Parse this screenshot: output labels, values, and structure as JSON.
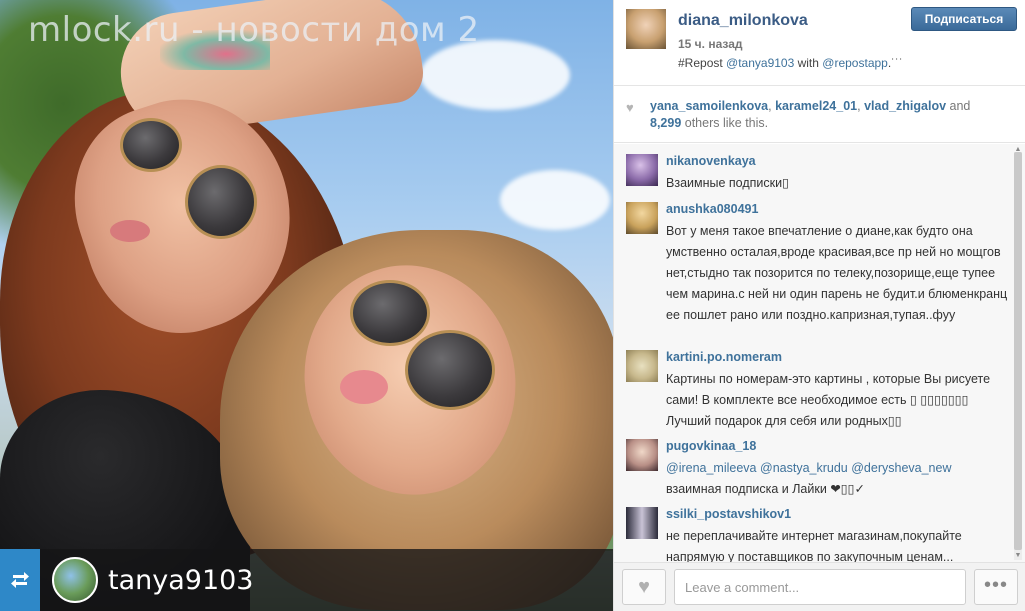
{
  "watermark": "mlock.ru - новости дом 2",
  "repost_bar": {
    "username": "tanya9103"
  },
  "post": {
    "author": "diana_milonkova",
    "time": "15 ч. назад",
    "follow_label": "Подписаться",
    "caption": {
      "prefix": "#Repost ",
      "mention1": "@tanya9103",
      "middle": " with ",
      "mention2": "@repostapp",
      "suffix": ".˙˙˙"
    }
  },
  "likes": {
    "users": [
      "yana_samoilenkova",
      "karamel24_01",
      "vlad_zhigalov"
    ],
    "sep1": ", ",
    "sep2": ", ",
    "and": " and",
    "count": "8,299",
    "others": " others like this."
  },
  "comments": [
    {
      "user": "nikanovenkaya",
      "text": "Взаимные подписки▯"
    },
    {
      "user": "anushka080491",
      "text": "Вот у меня такое впечатление о диане,как будто она умственно осталая,вроде красивая,все пр ней но мощгов нет,стыдно так позорится по телеку,позорище,еще тупее чем марина.с ней ни один парень не будит.и блюменкранц ее пошлет рано или поздно.капризная,тупая..фуу"
    },
    {
      "user": "kartini.po.nomeram",
      "text": "Картины по номерам-это картины , которые Вы рисуете сами! В комплекте все необходимое есть ▯ ▯▯▯▯▯▯▯ Лучший подарок для себя или родных▯▯"
    },
    {
      "user": "pugovkinaa_18",
      "mentions": [
        "@irena_mileeva",
        "@nastya_krudu",
        "@derysheva_new"
      ],
      "text": "взаимная подписка и Лайки ❤▯▯✓"
    },
    {
      "user": "ssilki_postavshikov1",
      "text": "не переплачивайте интернет магазинам,покупайте напрямую у поставщиков по закупочным ценам..."
    }
  ],
  "footer": {
    "comment_placeholder": "Leave a comment...",
    "more_label": "•••"
  },
  "colors": {
    "link": "#3f729b",
    "follow": "#3a6a99",
    "repost_icon_bg": "#2e88c8"
  }
}
